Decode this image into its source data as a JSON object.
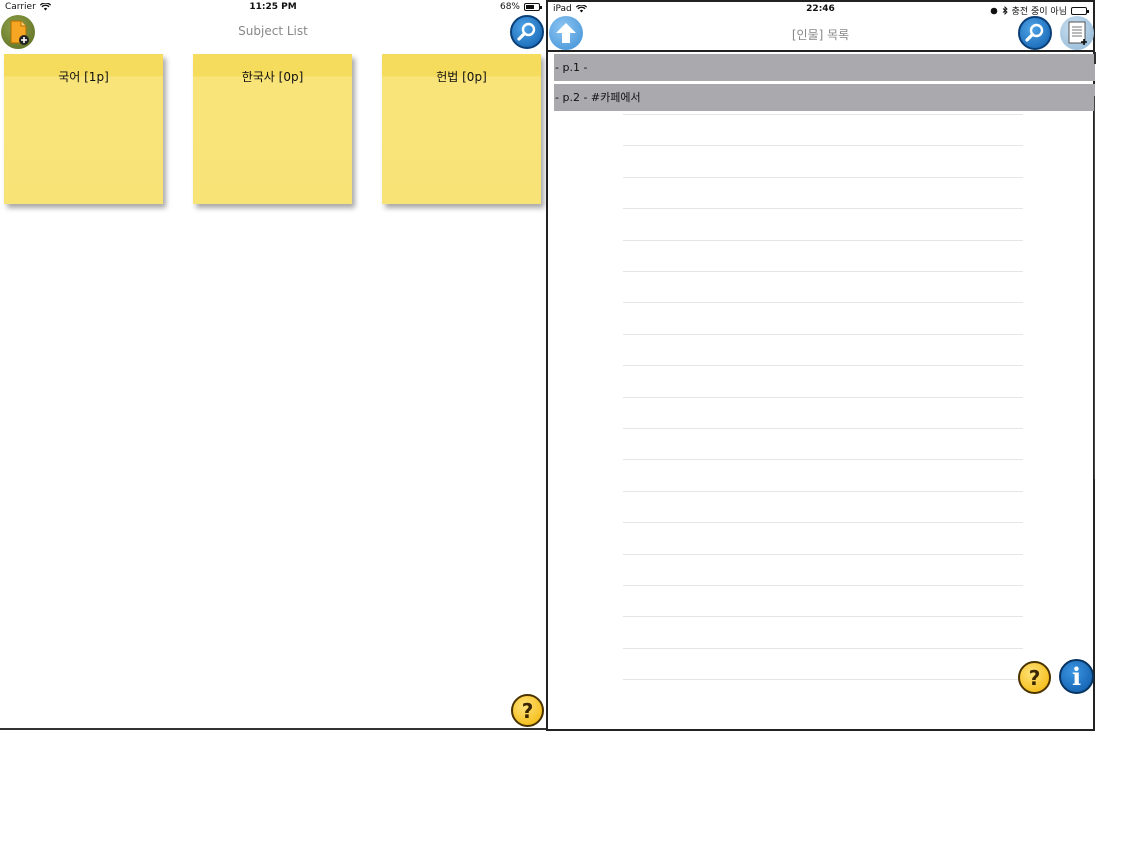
{
  "left": {
    "status": {
      "carrier": "Carrier",
      "time": "11:25 PM",
      "battery": "68%",
      "battery_level": 0.68
    },
    "title": "Subject List",
    "notes": [
      {
        "label": "국어 [1p]"
      },
      {
        "label": "한국사 [0p]"
      },
      {
        "label": "헌법 [0p]"
      }
    ],
    "help_label": "?"
  },
  "right": {
    "status": {
      "device": "iPad",
      "time": "22:46",
      "charging": "충전 중이 아님"
    },
    "title": "[인물] 목록",
    "pages": [
      {
        "label": "- p.1 -"
      },
      {
        "label": "- p.2 - #카페에서"
      }
    ],
    "help_label": "?",
    "info_label": "i"
  },
  "colors": {
    "sticky": "#f8e377",
    "row": "#a9a9ae",
    "search": "#0e5fae",
    "help": "#f2b400"
  }
}
